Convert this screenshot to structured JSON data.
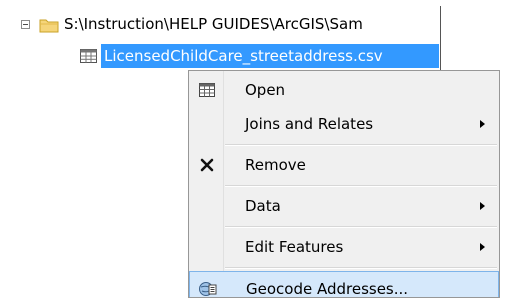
{
  "toc": {
    "folder": {
      "path": "S:\\Instruction\\HELP GUIDES\\ArcGIS\\Sam",
      "expander_icon": "collapse-minus-icon",
      "icon": "folder-icon"
    },
    "layer": {
      "name": "LicensedChildCare_streetaddress.csv",
      "icon": "table-icon",
      "selected": true
    }
  },
  "context_menu": {
    "items": [
      {
        "label": "Open",
        "icon": "table-icon",
        "submenu": false
      },
      {
        "label": "Joins and Relates",
        "icon": null,
        "submenu": true
      },
      {
        "label": "Remove",
        "icon": "remove-x-icon",
        "submenu": false
      },
      {
        "label": "Data",
        "icon": null,
        "submenu": true
      },
      {
        "label": "Edit Features",
        "icon": null,
        "submenu": true
      },
      {
        "label": "Geocode Addresses...",
        "icon": "geocode-icon",
        "submenu": false,
        "highlighted": true
      }
    ]
  },
  "colors": {
    "selection": "#3399ff",
    "menu_background": "#f0f0f0",
    "menu_highlight": "#d5e8fb",
    "menu_highlight_border": "#7eb4ea",
    "folder": "#f5d57a"
  }
}
